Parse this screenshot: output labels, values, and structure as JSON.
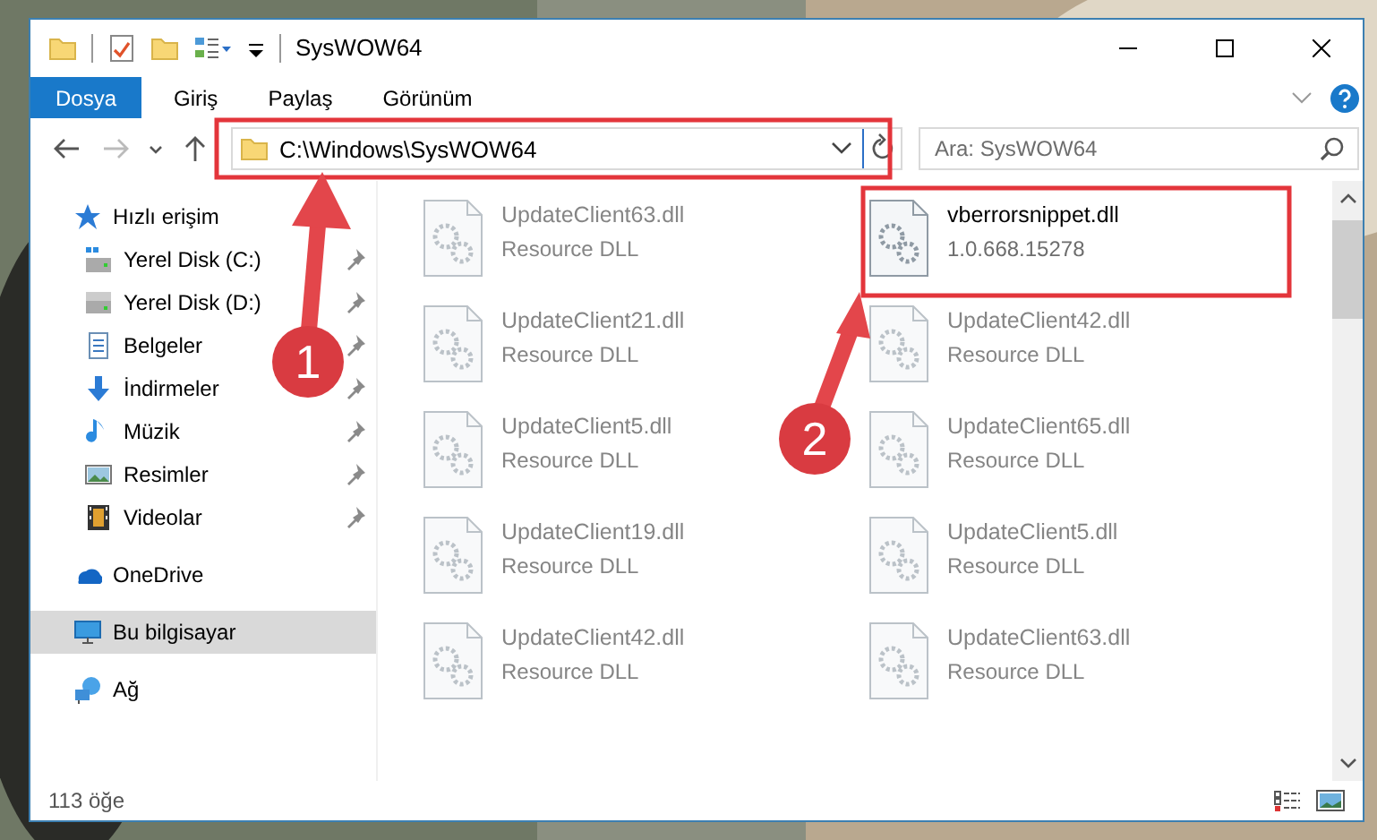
{
  "window": {
    "title": "SysWOW64"
  },
  "ribbon_tabs": [
    {
      "label": "Dosya",
      "kind": "file"
    },
    {
      "label": "Giriş",
      "kind": "tab"
    },
    {
      "label": "Paylaş",
      "kind": "tab"
    },
    {
      "label": "Görünüm",
      "kind": "tab"
    }
  ],
  "address": {
    "path": "C:\\Windows\\SysWOW64"
  },
  "search": {
    "placeholder": "Ara: SysWOW64"
  },
  "sidebar": {
    "items": [
      {
        "label": "Hızlı erişim",
        "selected": false,
        "children": [
          {
            "label": "Yerel Disk (C:)",
            "pinned": true
          },
          {
            "label": "Yerel Disk (D:)",
            "pinned": true
          },
          {
            "label": "Belgeler",
            "pinned": true
          },
          {
            "label": "İndirmeler",
            "pinned": true
          },
          {
            "label": "Müzik",
            "pinned": true
          },
          {
            "label": "Resimler",
            "pinned": true
          },
          {
            "label": "Videolar",
            "pinned": true
          }
        ]
      },
      {
        "label": "OneDrive",
        "selected": false
      },
      {
        "label": "Bu bilgisayar",
        "selected": true
      },
      {
        "label": "Ağ",
        "selected": false
      }
    ]
  },
  "files": [
    {
      "name": "UpdateClient63.dll",
      "detail": "Resource DLL",
      "blurred": true
    },
    {
      "name": "vberrorsnippet.dll",
      "detail": "1.0.668.15278",
      "blurred": false
    },
    {
      "name": "UpdateClient21.dll",
      "detail": "Resource DLL",
      "blurred": true
    },
    {
      "name": "UpdateClient42.dll",
      "detail": "Resource DLL",
      "blurred": true
    },
    {
      "name": "UpdateClient5.dll",
      "detail": "Resource DLL",
      "blurred": true
    },
    {
      "name": "UpdateClient65.dll",
      "detail": "Resource DLL",
      "blurred": true
    },
    {
      "name": "UpdateClient19.dll",
      "detail": "Resource DLL",
      "blurred": true
    },
    {
      "name": "UpdateClient5.dll",
      "detail": "Resource DLL",
      "blurred": true
    },
    {
      "name": "UpdateClient42.dll",
      "detail": "Resource DLL",
      "blurred": true
    },
    {
      "name": "UpdateClient63.dll",
      "detail": "Resource DLL",
      "blurred": true
    }
  ],
  "status_bar": {
    "count": "113 öğe"
  },
  "annotations": [
    {
      "label": "1"
    },
    {
      "label": "2"
    }
  ]
}
